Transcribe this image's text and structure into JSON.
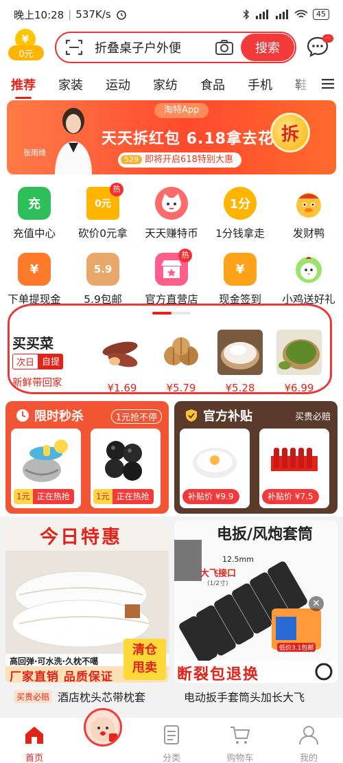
{
  "status_bar": {
    "time": "晚上10:28",
    "speed": "537K/s",
    "battery": "45"
  },
  "header": {
    "coin_symbol": "¥",
    "coin_label": "0元",
    "search_text": "折叠桌子户外便",
    "search_button": "搜索"
  },
  "tabs": [
    "推荐",
    "家装",
    "运动",
    "家纺",
    "食品",
    "手机",
    "鞋"
  ],
  "banner": {
    "tag": "淘特App",
    "person_name": "张雨绮",
    "main_text": "天天拆红包 6.18拿去花",
    "sub_tag": "529",
    "sub_text": "即将开启618特别大惠",
    "chai": "拆"
  },
  "grid_row1": [
    {
      "label": "充值中心",
      "icon": "充",
      "badge": ""
    },
    {
      "label": "砍价0元拿",
      "icon": "0元",
      "badge": "热"
    },
    {
      "label": "天天赚特币",
      "icon": "",
      "badge": ""
    },
    {
      "label": "1分钱拿走",
      "icon": "1分",
      "badge": ""
    },
    {
      "label": "发财鸭",
      "icon": "",
      "badge": ""
    }
  ],
  "grid_row2": [
    {
      "label": "下单提现金",
      "icon": "¥",
      "badge": ""
    },
    {
      "label": "5.9包邮",
      "icon": "5.9",
      "badge": ""
    },
    {
      "label": "官方直营店",
      "icon": "",
      "badge": "热"
    },
    {
      "label": "现金签到",
      "icon": "¥",
      "badge": ""
    },
    {
      "label": "小鸡送好礼",
      "icon": "",
      "badge": ""
    }
  ],
  "veg": {
    "title": "买买菜",
    "tag1": "次日",
    "tag2": "自提",
    "subtitle": "新鲜带回家",
    "items": [
      {
        "price": "¥1.69"
      },
      {
        "price": "¥5.79"
      },
      {
        "price": "¥5.28"
      },
      {
        "price": "¥6.99"
      }
    ]
  },
  "flash_sale": {
    "title": "限时秒杀",
    "subtitle": "1元抢不停",
    "items": [
      {
        "price": "1元",
        "status": "正在热抢"
      },
      {
        "price": "1元",
        "status": "正在热抢"
      }
    ]
  },
  "subsidy": {
    "title": "官方补贴",
    "subtitle": "买贵必赔",
    "items": [
      {
        "label": "补贴价 ¥9.9"
      },
      {
        "label": "补贴价 ¥7.5"
      }
    ]
  },
  "feed": {
    "left": {
      "banner": "今日特惠",
      "caption1": "高回弹·可水洗·久枕不噶",
      "caption2": "厂家直销 品质保证",
      "stamp1": "清仓",
      "stamp2": "甩卖",
      "badge": "买贵必赔",
      "name": "酒店枕头芯带枕套"
    },
    "right": {
      "banner": "电扳/风炮套筒",
      "size": "12.5mm",
      "spec1": "大飞接口",
      "spec2": "(1/2寸)",
      "bottom": "断裂包退换",
      "ad_text": "低价3.1包邮",
      "name": "电动扳手套筒头加长大飞"
    }
  },
  "bottom_nav": [
    {
      "label": "首页"
    },
    {
      "label": ""
    },
    {
      "label": "分类"
    },
    {
      "label": "购物车"
    },
    {
      "label": "我的"
    }
  ],
  "colors": {
    "accent": "#e2231a",
    "search_border": "#f23030"
  }
}
